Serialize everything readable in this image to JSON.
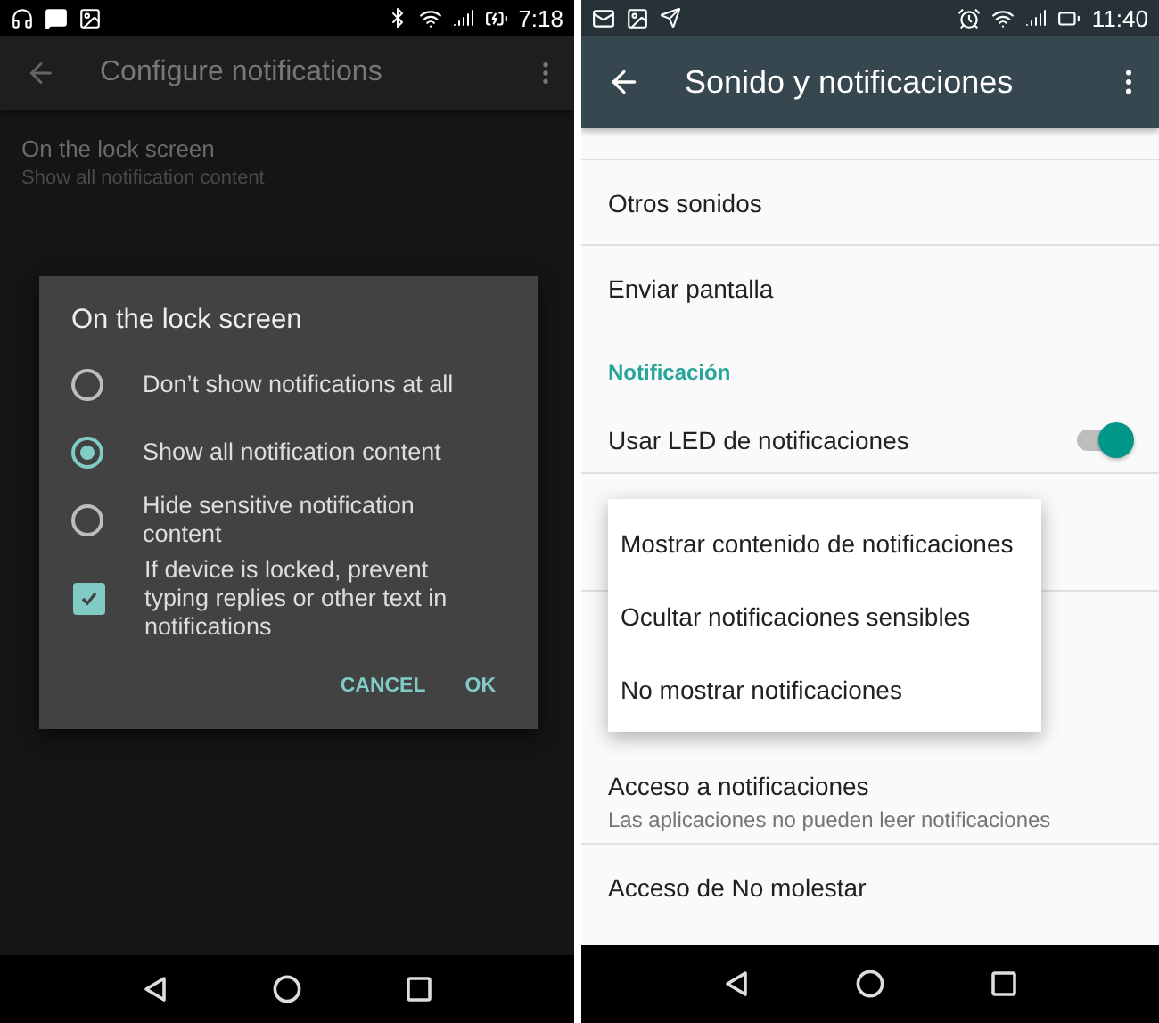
{
  "left_screen": {
    "status_bar": {
      "time": "7:18"
    },
    "toolbar": {
      "title": "Configure notifications"
    },
    "items": [
      {
        "title": "On the lock screen",
        "subtitle": "Show all notification content"
      }
    ],
    "dialog": {
      "title": "On the lock screen",
      "options": [
        {
          "kind": "radio",
          "label": "Don’t show notifications at all",
          "selected": false
        },
        {
          "kind": "radio",
          "label": "Show all notification content",
          "selected": true
        },
        {
          "kind": "radio",
          "label": "Hide sensitive notification content",
          "selected": false
        },
        {
          "kind": "checkbox",
          "label": "If device is locked, prevent typing replies or other text in notifications",
          "checked": true
        }
      ],
      "buttons": [
        "CANCEL",
        "OK"
      ]
    }
  },
  "right_screen": {
    "status_bar": {
      "time": "11:40"
    },
    "toolbar": {
      "title": "Sonido y notificaciones"
    },
    "rows": [
      {
        "kind": "partial"
      },
      {
        "kind": "item",
        "title": "Otros sonidos"
      },
      {
        "kind": "item",
        "title": "Enviar pantalla",
        "divider": false
      },
      {
        "kind": "header",
        "title": "Notificación"
      },
      {
        "kind": "switch",
        "title": "Usar LED de notificaciones",
        "on": true
      },
      {
        "kind": "hidden"
      },
      {
        "kind": "hidden_header"
      },
      {
        "kind": "item",
        "title": "Acceso a notificaciones",
        "subtitle": "Las aplicaciones no pueden leer notificaciones"
      },
      {
        "kind": "item",
        "title": "Acceso de No molestar",
        "divider": false
      }
    ],
    "menu": [
      {
        "label": "Mostrar contenido de notificaciones"
      },
      {
        "label": "Ocultar notificaciones sensibles"
      },
      {
        "label": "No mostrar notificaciones"
      }
    ]
  }
}
